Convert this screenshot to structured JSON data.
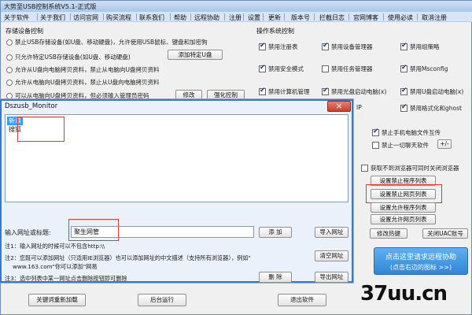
{
  "window": {
    "title": "大势至USB控制系统V5.1-正式版"
  },
  "menu": [
    "关于软件",
    "关于我们",
    "访问官网",
    "购买流程",
    "联系我们",
    "帮助",
    "远程协助",
    "注册",
    "设置",
    "更新",
    "版本号",
    "拦截日志",
    "官网博客",
    "使用必读",
    "取消注册"
  ],
  "usb": {
    "title": "存储设备控制",
    "options": [
      "禁止USB存储设备(如U盘、移动硬盘)，允许使用USB鼠标、键盘和加密狗",
      "只允许特定USB存储设备(如U盘、移动硬盘)",
      "允许从U盘向电脑拷贝资料，禁止从电脑向U盘拷贝资料",
      "允许从电脑向U盘拷贝资料，禁止从U盘向电脑拷贝资料",
      "可以从电脑向U盘拷贝资料，但必须输入管理员密码"
    ],
    "add_specific_btn": "添加特定U盘",
    "modify_btn": "修改",
    "strengthen_btn": "强化控制"
  },
  "ops": {
    "title": "操作系统控制",
    "items": [
      {
        "label": "禁用注册表",
        "checked": true
      },
      {
        "label": "禁用设备管理器",
        "checked": true
      },
      {
        "label": "禁用组策略",
        "checked": true
      },
      {
        "label": "禁用安全模式",
        "checked": true
      },
      {
        "label": "禁用任务管理器",
        "checked": false
      },
      {
        "label": "禁用Msconfig",
        "checked": true
      },
      {
        "label": "禁用计算机管理",
        "checked": true
      },
      {
        "label": "禁用光盘启动电脑(x)",
        "checked": true
      },
      {
        "label": "禁用U盘启动电脑(x)",
        "checked": true
      },
      {
        "label": "禁用格式化和ghost",
        "checked": true
      }
    ],
    "partial_ip": "IP"
  },
  "right": {
    "block_phone": "禁止手机电脑文件互传",
    "block_soft": "禁止一切聊天软件",
    "small_btn": "+/-",
    "browser_check": "获取不到浏览器可同时关闭浏览器",
    "set_prog_list": "设置禁止程序列表",
    "set_web_list": "设置禁止网页列表",
    "allow_prog_list": "设置允许程序列表",
    "allow_web_list": "设置允许网页列表",
    "modify_hotkey": "修改热键",
    "close_uac": "关闭UAC账号"
  },
  "remote": {
    "line1": "点击这里请求远程协助",
    "line2": "(点击右边的图标 >>)"
  },
  "bottom": {
    "reload": "关键词重新加载",
    "background": "后台运行",
    "exit": "退出软件"
  },
  "left_partial": [
    "端",
    "智",
    "当"
  ],
  "dialog": {
    "title": "Dszusb_Monitor",
    "close": "×",
    "list_items": [
      "新浪",
      "搜狐"
    ],
    "input_label": "输入网址或标题:",
    "input_value": "聚生网管",
    "add_btn": "添 加",
    "import_btn": "导入网址",
    "clear_btn": "清空网址",
    "delete_btn": "删 除",
    "export_btn": "导出网址",
    "notes": [
      "注1：输入网址的时候可以不包含http:\\\\",
      "注2：您既可以添加网址（只适用IE浏览器）也可以添加网址的中文描述（支持所有浏览器），例如\"",
      "www.163.com\"你可以添加\"网易",
      "注3：选中列表中某一网址点击删除按钮即可删除"
    ]
  },
  "watermark": "37uu.cn",
  "colors": {
    "accent": "#3c78c8",
    "highlight": "#e03a3a",
    "remote_btn": "#2f86d6"
  }
}
